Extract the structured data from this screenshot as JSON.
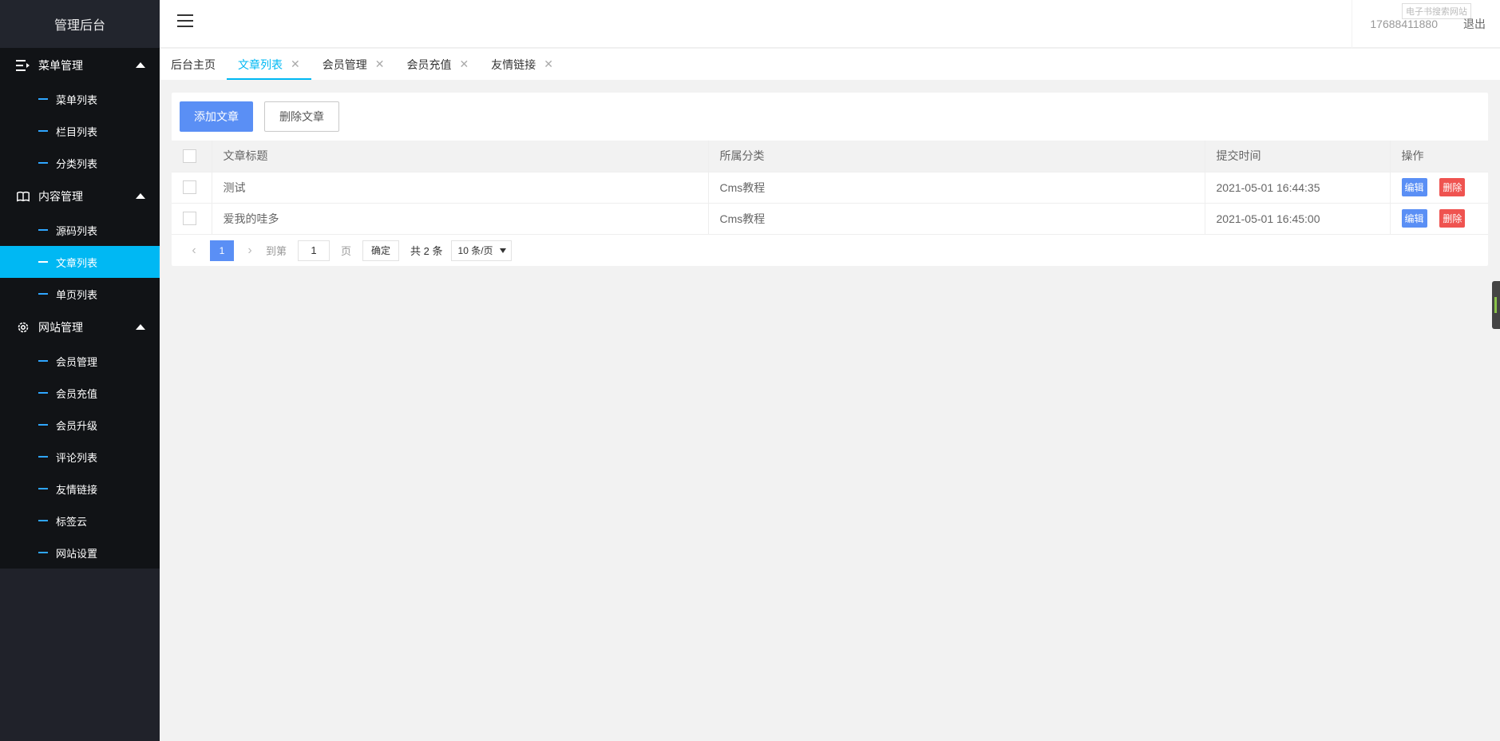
{
  "sidebar": {
    "logo": "管理后台",
    "groups": [
      {
        "title": "菜单管理",
        "icon": "list-icon",
        "items": [
          "菜单列表",
          "栏目列表",
          "分类列表"
        ]
      },
      {
        "title": "内容管理",
        "icon": "book-icon",
        "items": [
          "源码列表",
          "文章列表",
          "单页列表"
        ]
      },
      {
        "title": "网站管理",
        "icon": "gear-icon",
        "items": [
          "会员管理",
          "会员充值",
          "会员升级",
          "评论列表",
          "友情链接",
          "标签云",
          "网站设置"
        ]
      }
    ],
    "active_item": "文章列表"
  },
  "header": {
    "user": "17688411880",
    "logout": "退出",
    "tip": "电子书搜索网站"
  },
  "tabs": [
    {
      "label": "后台主页",
      "closable": false
    },
    {
      "label": "文章列表",
      "closable": true,
      "active": true
    },
    {
      "label": "会员管理",
      "closable": true
    },
    {
      "label": "会员充值",
      "closable": true
    },
    {
      "label": "友情链接",
      "closable": true
    }
  ],
  "toolbar": {
    "add_label": "添加文章",
    "delete_label": "删除文章"
  },
  "table": {
    "columns": [
      "文章标题",
      "所属分类",
      "提交时间",
      "操作"
    ],
    "rows": [
      {
        "title": "测试",
        "category": "Cms教程",
        "time": "2021-05-01 16:44:35"
      },
      {
        "title": "爱我的哇多",
        "category": "Cms教程",
        "time": "2021-05-01 16:45:00"
      }
    ],
    "edit_label": "编辑",
    "delete_label": "删除"
  },
  "pager": {
    "current": "1",
    "goto_label": "到第",
    "goto_value": "1",
    "page_label": "页",
    "confirm_label": "确定",
    "total": "共 2 条",
    "page_size": "10 条/页"
  },
  "colors": {
    "sidebar_bg": "#20222a",
    "active": "#00b8f3",
    "primary": "#5a8ff5",
    "danger": "#ef5350"
  }
}
